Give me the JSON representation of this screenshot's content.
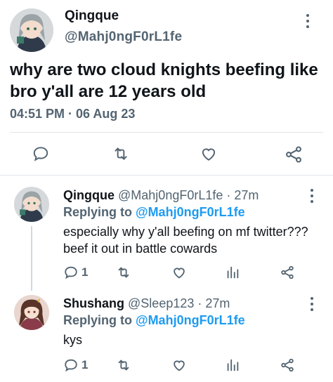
{
  "main_tweet": {
    "display_name": "Qingque",
    "handle": "@Mahj0ngF0rL1fe",
    "text": "why are two cloud knights beefing like bro y'all are 12 years old",
    "timestamp": "04:51 PM · 06 Aug 23"
  },
  "replies": [
    {
      "display_name": "Qingque",
      "handle": "@Mahj0ngF0rL1fe",
      "time": "· 27m",
      "replying_label": "Replying to",
      "replying_handle": "@Mahj0ngF0rL1fe",
      "text": "especially why y'all beefing on mf twitter??? beef it out in battle cowards",
      "reply_count": "1"
    },
    {
      "display_name": "Shushang",
      "handle": "@Sleep123",
      "time": "· 27m",
      "replying_label": "Replying to",
      "replying_handle": "@Mahj0ngF0rL1fe",
      "text": "kys",
      "reply_count": "1"
    }
  ],
  "colors": {
    "accent": "#1d9bf0",
    "secondary_text": "#536471",
    "divider": "#e1e6ea"
  },
  "icons": [
    "more-icon",
    "reply-icon",
    "retweet-icon",
    "like-icon",
    "share-icon",
    "views-icon"
  ]
}
